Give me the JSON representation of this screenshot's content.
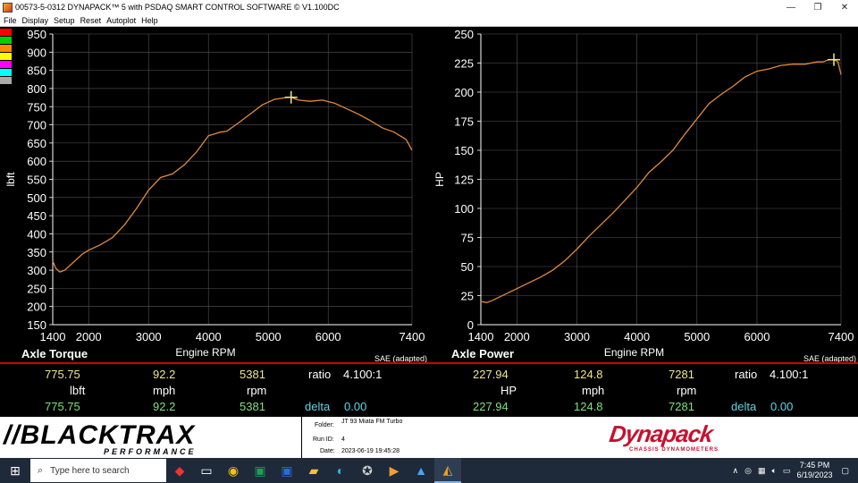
{
  "window": {
    "title": "00573-5-0312 DYNAPACK™ 5 with PSDAQ SMART CONTROL SOFTWARE © V1.100DC",
    "minimize": "—",
    "maximize": "❐",
    "close": "✕"
  },
  "menu": [
    "File",
    "Display",
    "Setup",
    "Reset",
    "Autoplot",
    "Help"
  ],
  "swatches": [
    "#ff0000",
    "#00d000",
    "#ff8c00",
    "#ffff00",
    "#ff00ff",
    "#00ffff",
    "#aaaaaa"
  ],
  "colors": {
    "curve": "#e08a3c",
    "grid": "#555555",
    "cursor": "#f0e68c",
    "separator": "#cc0000"
  },
  "chart_data": [
    {
      "type": "line",
      "title": "Axle Torque",
      "xlabel": "Engine RPM",
      "ylabel": "lbft",
      "note": "SAE (adapted)",
      "xlim": [
        1400,
        7400
      ],
      "ylim": [
        150,
        950
      ],
      "xticks": [
        1400,
        2000,
        3000,
        4000,
        5000,
        6000,
        7400
      ],
      "yticks": [
        150,
        200,
        250,
        300,
        350,
        400,
        450,
        500,
        550,
        600,
        650,
        700,
        750,
        800,
        850,
        900,
        950
      ],
      "grid": true,
      "cursor": {
        "x": 5381,
        "y": 775.75
      },
      "series": [
        {
          "x": [
            1400,
            1450,
            1520,
            1600,
            1700,
            1800,
            1900,
            2000,
            2200,
            2400,
            2600,
            2800,
            3000,
            3200,
            3400,
            3600,
            3800,
            4000,
            4100,
            4200,
            4300,
            4500,
            4700,
            4900,
            5100,
            5300,
            5381,
            5500,
            5700,
            5900,
            6100,
            6300,
            6500,
            6700,
            6900,
            7100,
            7200,
            7300,
            7400
          ],
          "y": [
            325,
            305,
            295,
            300,
            315,
            330,
            345,
            355,
            370,
            390,
            425,
            470,
            520,
            555,
            565,
            590,
            625,
            670,
            675,
            680,
            682,
            705,
            730,
            755,
            770,
            775,
            775.75,
            768,
            765,
            768,
            760,
            745,
            730,
            712,
            692,
            680,
            670,
            660,
            630
          ]
        }
      ]
    },
    {
      "type": "line",
      "title": "Axle Power",
      "xlabel": "Engine RPM",
      "ylabel": "HP",
      "note": "SAE (adapted)",
      "xlim": [
        1400,
        7400
      ],
      "ylim": [
        0,
        250
      ],
      "xticks": [
        1400,
        2000,
        3000,
        4000,
        5000,
        6000,
        7400
      ],
      "yticks": [
        0,
        25,
        50,
        75,
        100,
        125,
        150,
        175,
        200,
        225,
        250
      ],
      "grid": true,
      "cursor": {
        "x": 7281,
        "y": 227.94
      },
      "series": [
        {
          "x": [
            1400,
            1500,
            1600,
            1800,
            2000,
            2200,
            2400,
            2600,
            2800,
            3000,
            3200,
            3400,
            3600,
            3800,
            4000,
            4200,
            4400,
            4600,
            4800,
            5000,
            5200,
            5400,
            5600,
            5800,
            6000,
            6200,
            6400,
            6600,
            6800,
            7000,
            7100,
            7200,
            7281,
            7350,
            7400
          ],
          "y": [
            20,
            19,
            21,
            26,
            31,
            36,
            41,
            47,
            55,
            65,
            76,
            86,
            96,
            107,
            118,
            131,
            140,
            150,
            164,
            177,
            190,
            198,
            205,
            213,
            218,
            220,
            223,
            224,
            224,
            226,
            226,
            228,
            227.94,
            226,
            215
          ]
        }
      ]
    }
  ],
  "readouts": {
    "left": {
      "title": "Axle Torque",
      "note": "SAE (adapted)",
      "row1": [
        "775.75",
        "92.2",
        "5381"
      ],
      "units": [
        "lbft",
        "mph",
        "rpm"
      ],
      "row3": [
        "775.75",
        "92.2",
        "5381"
      ],
      "ratio_label": "ratio",
      "ratio_value": "4.100:1",
      "delta_label": "delta",
      "delta_value": "0.00"
    },
    "right": {
      "title": "Axle Power",
      "note": "SAE (adapted)",
      "row1": [
        "227.94",
        "124.8",
        "7281"
      ],
      "units": [
        "HP",
        "mph",
        "rpm"
      ],
      "row3": [
        "227.94",
        "124.8",
        "7281"
      ],
      "ratio_label": "ratio",
      "ratio_value": "4.100:1",
      "delta_label": "delta",
      "delta_value": "0.00"
    }
  },
  "run_info": {
    "folder_label": "Folder:",
    "folder_value": "JT 93 Miata FM Turbo",
    "run_label": "Run ID:",
    "run_value": "4",
    "date_label": "Date:",
    "date_value": "2023-06-19 19:45:28"
  },
  "logos": {
    "left_main": "//BLACKTRAX",
    "left_sub": "PERFORMANCE",
    "right_main": "Dynapack",
    "right_sub": "CHASSIS DYNAMOMETERS"
  },
  "taskbar": {
    "search_placeholder": "Type here to search",
    "time": "7:45 PM",
    "date": "6/19/2023"
  }
}
